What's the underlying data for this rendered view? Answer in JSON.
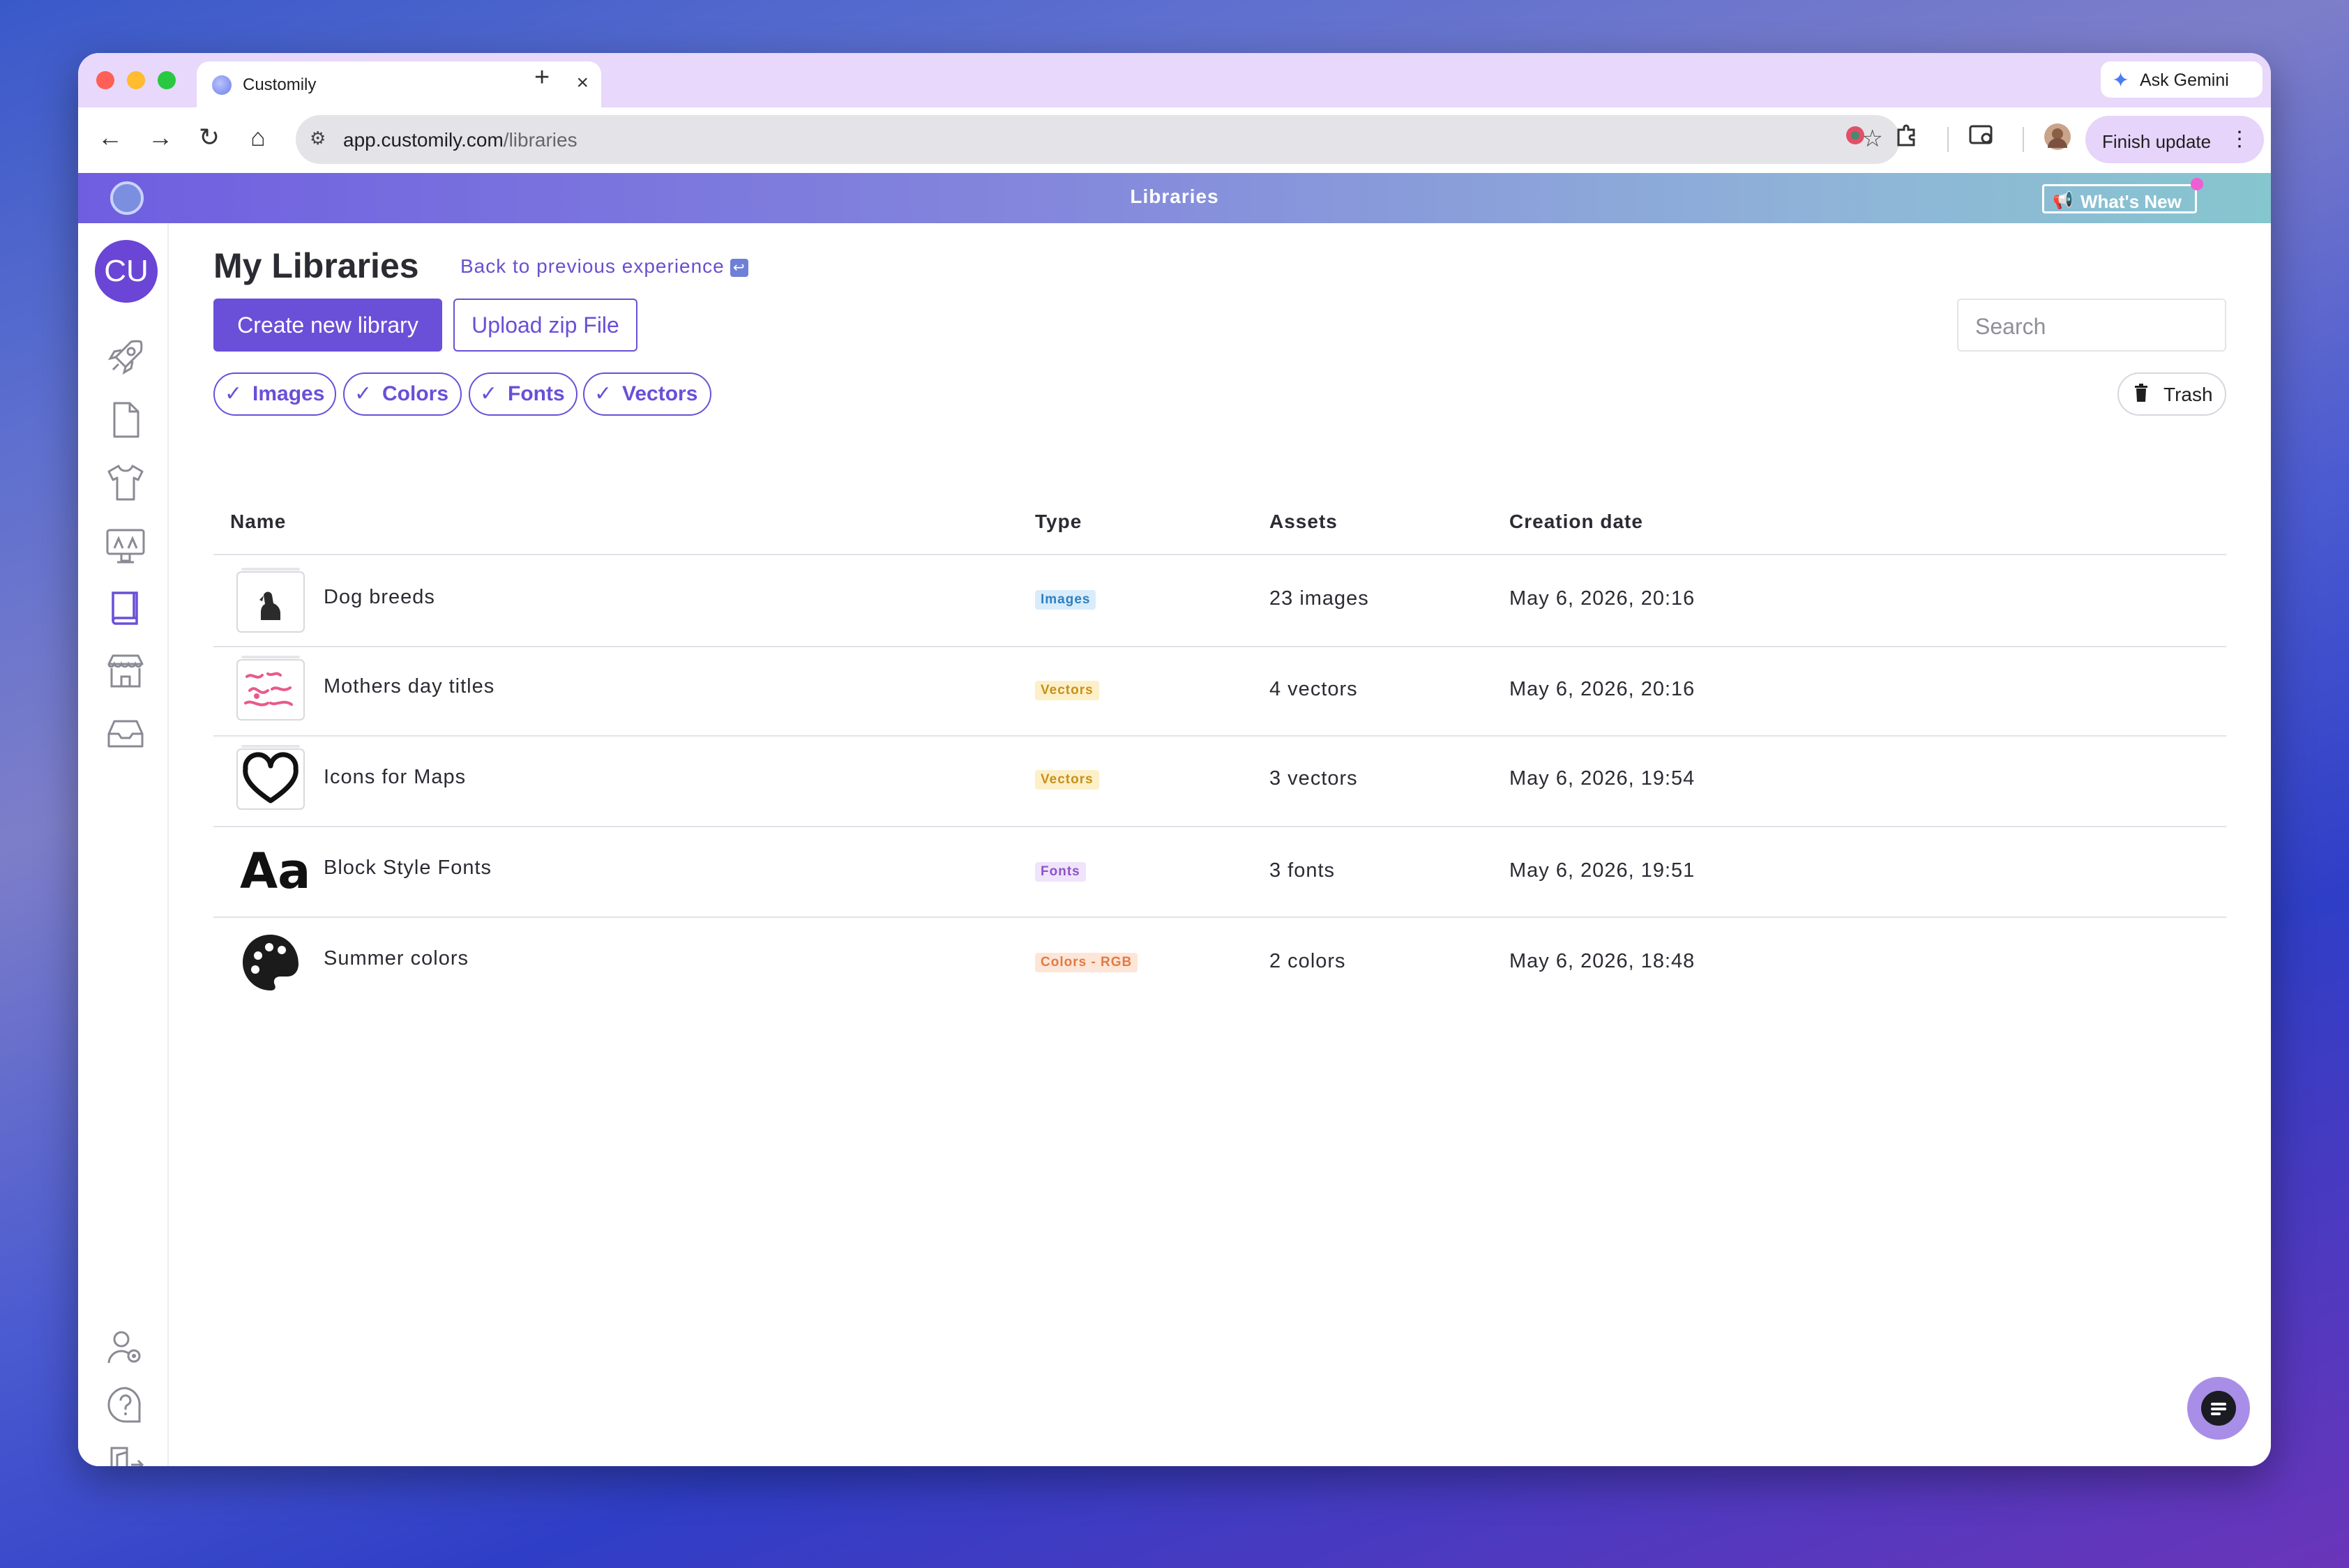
{
  "browser": {
    "tab_title": "Customily",
    "tab_close": "×",
    "new_tab": "+",
    "ask_gemini": "Ask Gemini",
    "url_host": "app.customily.com",
    "url_path": "/libraries",
    "finish_update": "Finish update",
    "more": "⋮",
    "nav": {
      "back": "←",
      "forward": "→",
      "reload": "↻",
      "home": "⌂"
    },
    "bookmark": "☆"
  },
  "app": {
    "header_title": "Libraries",
    "whats_new": "What's New",
    "avatar_initials": "CU",
    "sidebar_icons": [
      "rocket-icon",
      "document-icon",
      "tshirt-icon",
      "monitor-icon",
      "book-icon",
      "store-icon",
      "inbox-icon",
      "user-settings-icon",
      "help-icon",
      "logout-icon"
    ]
  },
  "page": {
    "title": "My Libraries",
    "back_link": "Back to previous experience",
    "create_button": "Create new library",
    "upload_button": "Upload zip File",
    "search_placeholder": "Search",
    "filters": [
      "Images",
      "Colors",
      "Fonts",
      "Vectors"
    ],
    "check": "✓",
    "trash": "Trash"
  },
  "table": {
    "headers": {
      "name": "Name",
      "type": "Type",
      "assets": "Assets",
      "date": "Creation date"
    },
    "rows": [
      {
        "name": "Dog breeds",
        "type": "Images",
        "assets": "23 images",
        "date": "May 6, 2026, 20:16",
        "thumb": "dog-icon",
        "badge_bg": "#d8ecfb",
        "badge_fg": "#2f7fc0"
      },
      {
        "name": "Mothers day titles",
        "type": "Vectors",
        "assets": "4 vectors",
        "date": "May 6, 2026, 20:16",
        "thumb": "pink-lettering-icon",
        "badge_bg": "#fdf0c9",
        "badge_fg": "#c7901a"
      },
      {
        "name": "Icons for Maps",
        "type": "Vectors",
        "assets": "3 vectors",
        "date": "May 6, 2026, 19:54",
        "thumb": "heart-icon",
        "badge_bg": "#fdf0c9",
        "badge_fg": "#c7901a"
      },
      {
        "name": "Block Style Fonts",
        "type": "Fonts",
        "assets": "3 fonts",
        "date": "May 6, 2026, 19:51",
        "thumb": "font-aa-icon",
        "badge_bg": "#efe4fb",
        "badge_fg": "#8f52c8"
      },
      {
        "name": "Summer colors",
        "type": "Colors - RGB",
        "assets": "2 colors",
        "date": "May 6, 2026, 18:48",
        "thumb": "palette-icon",
        "badge_bg": "#fde6d8",
        "badge_fg": "#e07b45"
      }
    ],
    "font_thumb_text": "Aa"
  },
  "colors": {
    "accent": "#6a4fd8",
    "titlebar": "#e8d8fb"
  }
}
